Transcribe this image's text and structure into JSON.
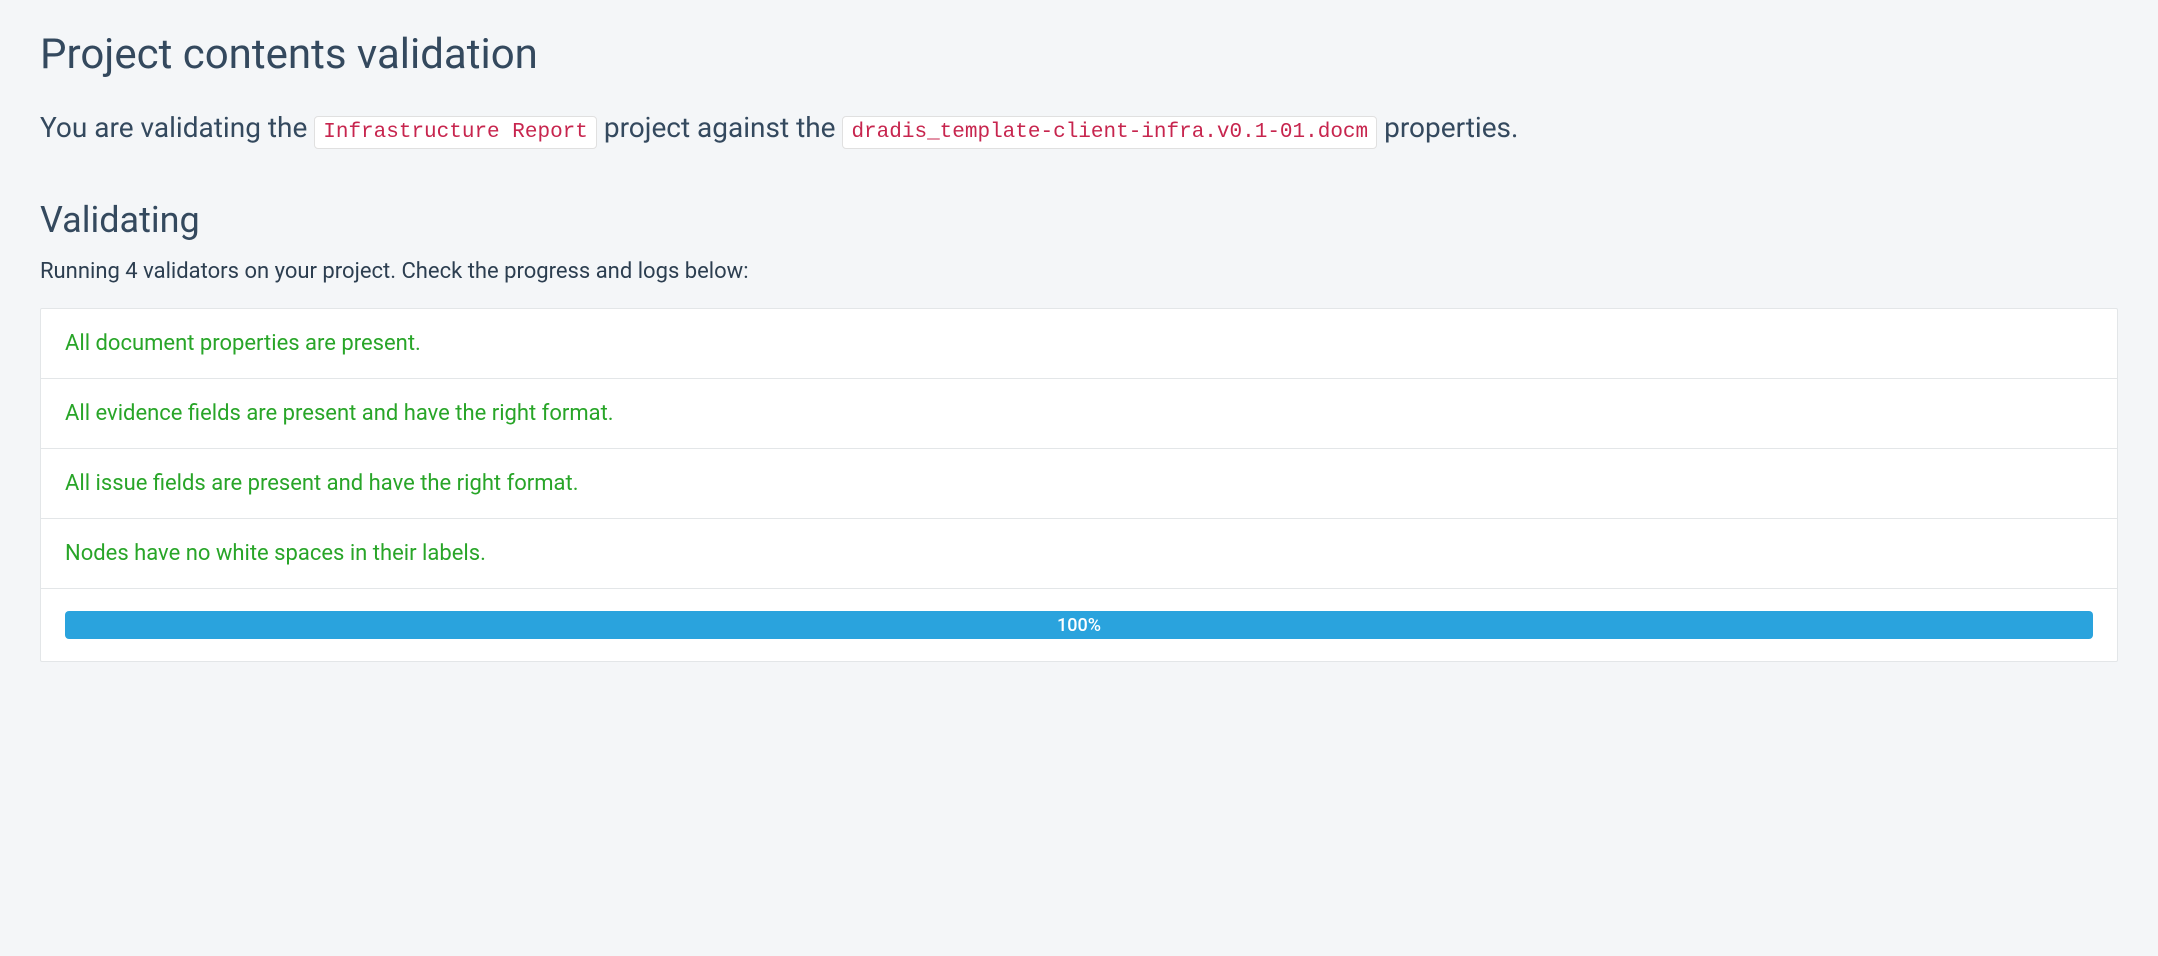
{
  "page": {
    "title": "Project contents validation"
  },
  "intro": {
    "prefix": "You are validating the ",
    "project_name": "Infrastructure Report",
    "middle": " project against the ",
    "template_name": "dradis_template-client-infra.v0.1-01.docm",
    "suffix": " properties."
  },
  "section": {
    "title": "Validating",
    "subtext": "Running 4 validators on your project. Check the progress and logs below:"
  },
  "validators": [
    {
      "message": "All document properties are present."
    },
    {
      "message": "All evidence fields are present and have the right format."
    },
    {
      "message": "All issue fields are present and have the right format."
    },
    {
      "message": "Nodes have no white spaces in their labels."
    }
  ],
  "progress": {
    "label": "100%",
    "percent": 100
  }
}
